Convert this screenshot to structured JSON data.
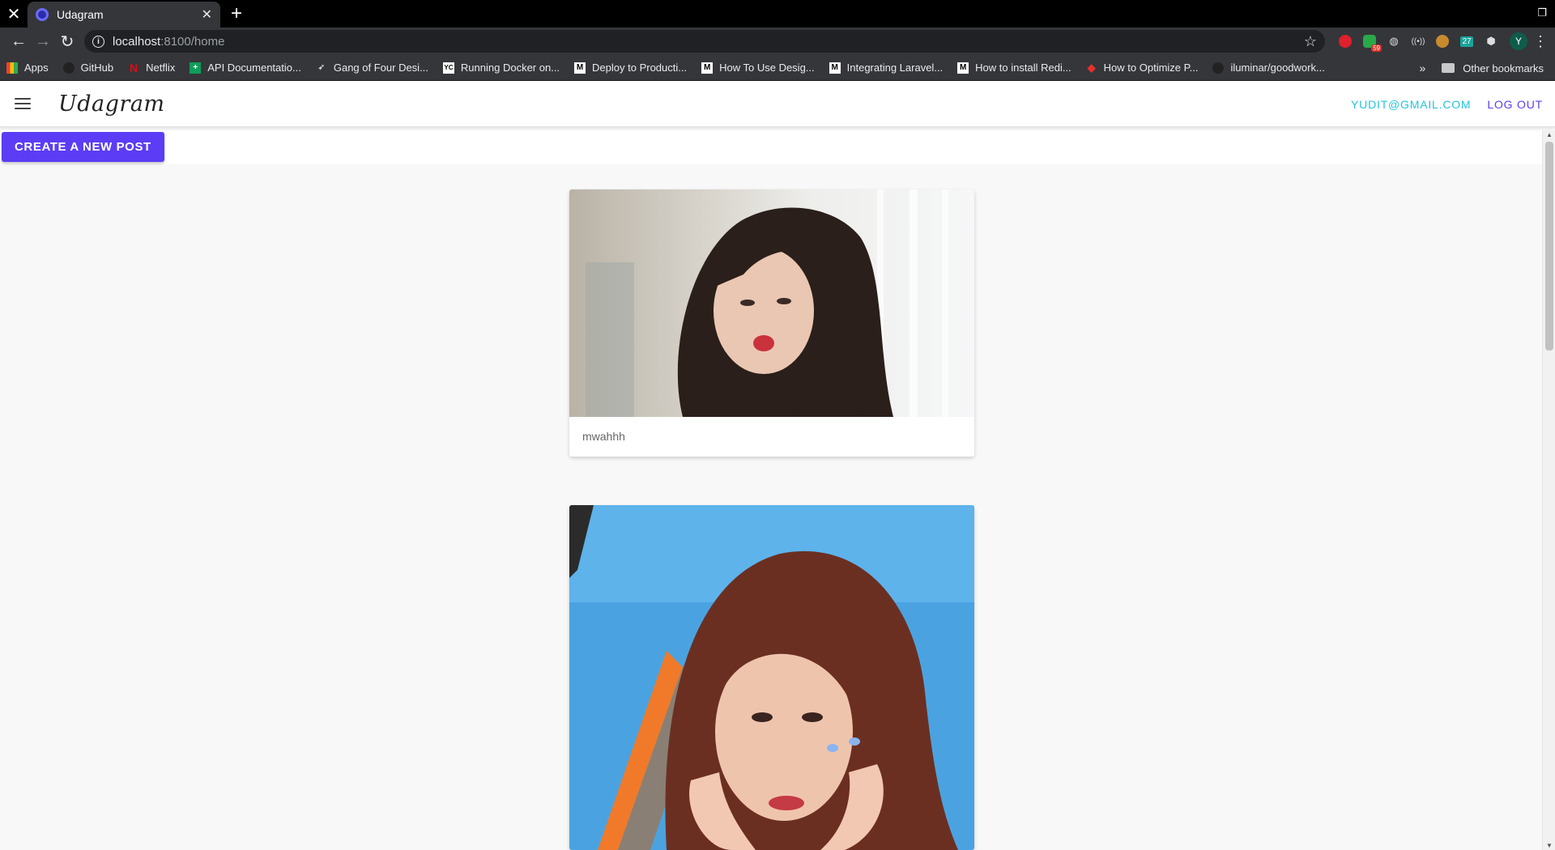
{
  "browser": {
    "tab_title": "Udagram",
    "url_host": "localhost",
    "url_rest": ":8100/home",
    "avatar_letter": "Y",
    "bookmarks": [
      {
        "label": "Apps",
        "icon": "apps-grid-icon"
      },
      {
        "label": "GitHub",
        "icon": "github-icon"
      },
      {
        "label": "Netflix",
        "icon": "netflix-icon"
      },
      {
        "label": "API Documentatio...",
        "icon": "sheets-icon"
      },
      {
        "label": "Gang of Four Desi...",
        "icon": "bird-icon"
      },
      {
        "label": "Running Docker on...",
        "icon": "yc-icon"
      },
      {
        "label": "Deploy to Producti...",
        "icon": "medium-icon"
      },
      {
        "label": "How To Use Desig...",
        "icon": "medium-icon"
      },
      {
        "label": "Integrating Laravel...",
        "icon": "medium-icon"
      },
      {
        "label": "How to install Redi...",
        "icon": "medium-icon"
      },
      {
        "label": "How to Optimize P...",
        "icon": "diamond-icon"
      },
      {
        "label": "iluminar/goodwork...",
        "icon": "github-icon"
      }
    ],
    "other_bookmarks": "Other bookmarks",
    "ext_badge": "59",
    "ext_calendar": "27"
  },
  "app": {
    "logo": "Udagram",
    "user_email": "YUDIT@GMAIL.COM",
    "logout_label": "LOG OUT",
    "create_post_label": "CREATE A NEW POST",
    "posts": [
      {
        "caption": "mwahhh"
      },
      {
        "caption": ""
      }
    ]
  },
  "colors": {
    "accent": "#5c3df5",
    "email": "#26c4dc"
  }
}
